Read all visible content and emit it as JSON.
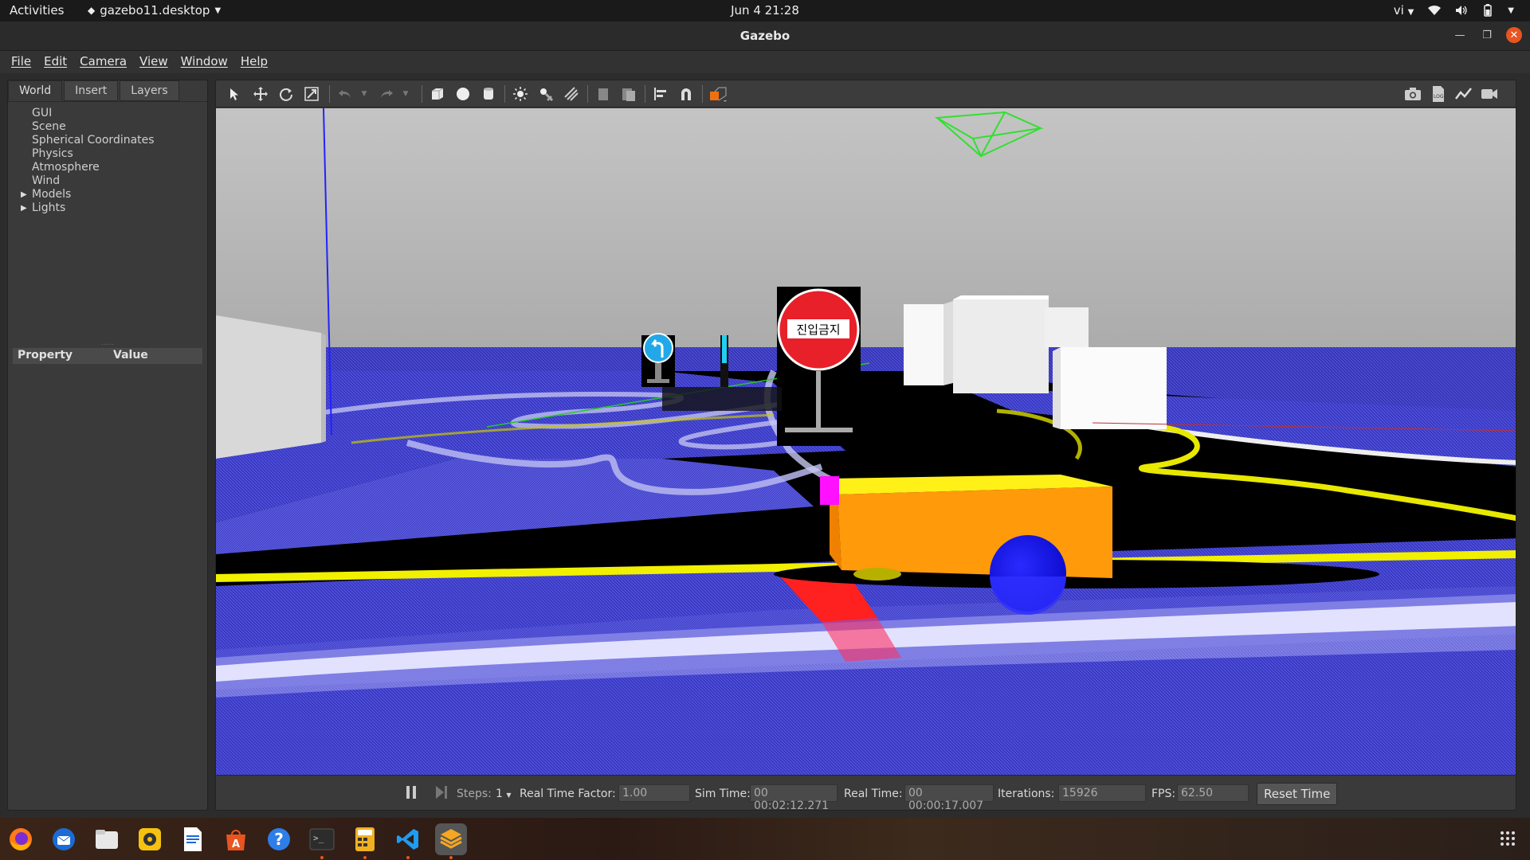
{
  "topbar": {
    "activities": "Activities",
    "app_menu": "gazebo11.desktop",
    "clock": "Jun 4  21:28",
    "input_method": "vi"
  },
  "window": {
    "title": "Gazebo"
  },
  "menubar": [
    "File",
    "Edit",
    "Camera",
    "View",
    "Window",
    "Help"
  ],
  "left_panel": {
    "tabs": [
      "World",
      "Insert",
      "Layers"
    ],
    "active_tab": "World",
    "tree": [
      {
        "label": "GUI",
        "expandable": false
      },
      {
        "label": "Scene",
        "expandable": false
      },
      {
        "label": "Spherical Coordinates",
        "expandable": false
      },
      {
        "label": "Physics",
        "expandable": false
      },
      {
        "label": "Atmosphere",
        "expandable": false
      },
      {
        "label": "Wind",
        "expandable": false
      },
      {
        "label": "Models",
        "expandable": true
      },
      {
        "label": "Lights",
        "expandable": true
      }
    ],
    "property_header": {
      "property": "Property",
      "value": "Value"
    }
  },
  "scene": {
    "sign_text": "진입금지"
  },
  "bottombar": {
    "steps_label": "Steps:",
    "steps_value": "1",
    "rtf_label": "Real Time Factor:",
    "rtf_value": "1.00",
    "sim_time_label": "Sim Time:",
    "sim_time_value": "00 00:02:12.271",
    "real_time_label": "Real Time:",
    "real_time_value": "00 00:00:17.007",
    "iterations_label": "Iterations:",
    "iterations_value": "15926",
    "fps_label": "FPS:",
    "fps_value": "62.50",
    "reset_label": "Reset Time"
  },
  "colors": {
    "accent": "#e95420",
    "robot_body": "#ff9a0a",
    "ground_blue": "#3434c8",
    "lane_yellow": "#f0f000"
  },
  "dock_apps": [
    "firefox-icon",
    "thunderbird-icon",
    "files-icon",
    "rhythmbox-icon",
    "writer-icon",
    "software-icon",
    "help-icon",
    "terminal-icon",
    "calculator-icon",
    "vscode-icon",
    "gazebo-icon"
  ]
}
